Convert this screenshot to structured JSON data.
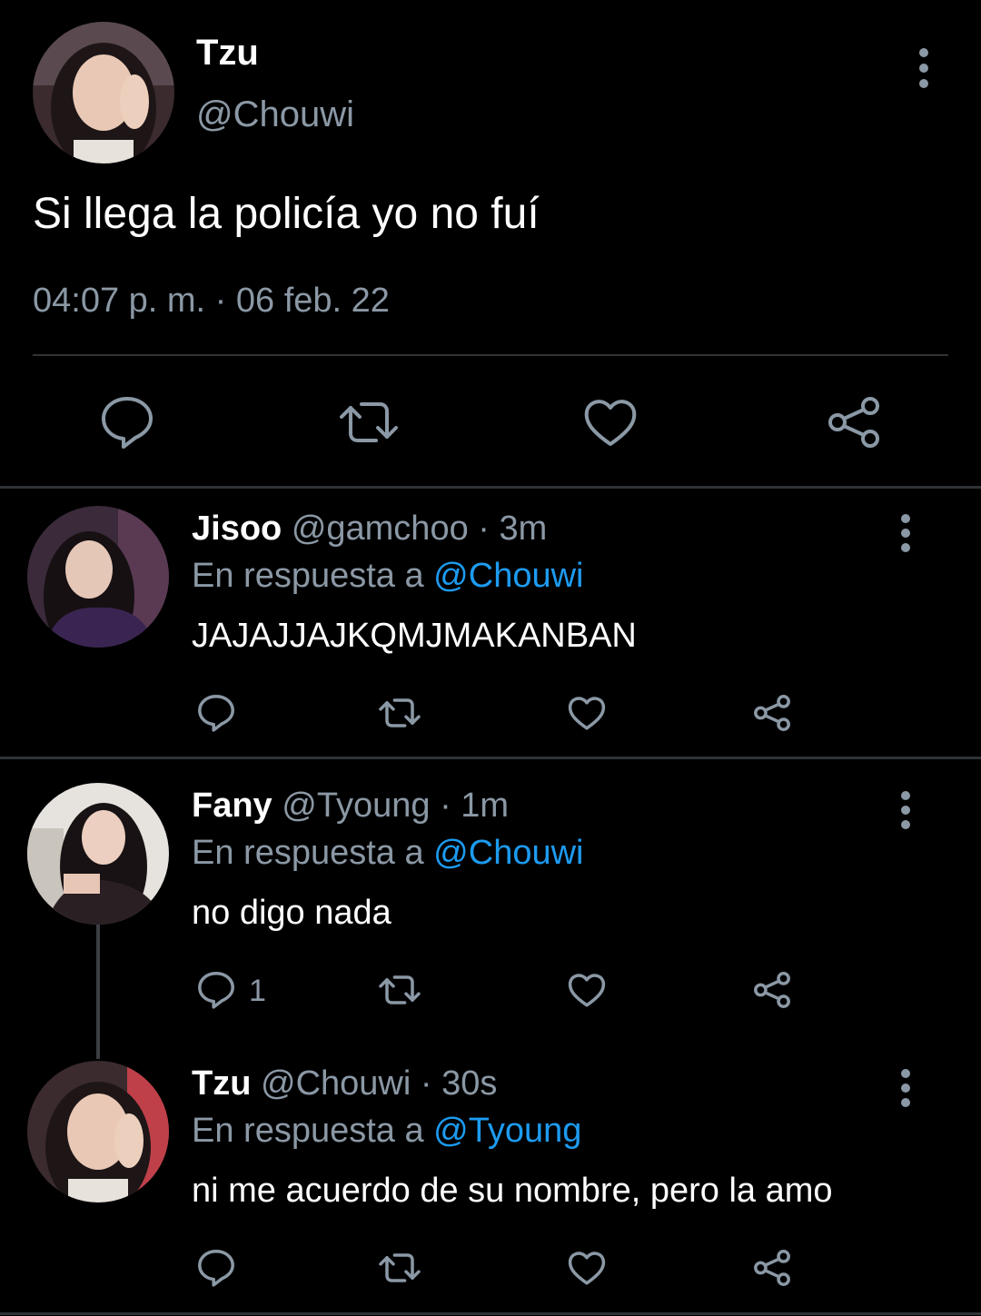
{
  "main_tweet": {
    "author_name": "Tzu",
    "author_handle": "@Chouwi",
    "text": "Si llega la policía yo no fuí",
    "timestamp": "04:07 p. m. · 06 feb. 22",
    "actions": [
      "reply-icon",
      "retweet-icon",
      "like-icon",
      "share-icon"
    ]
  },
  "replies": [
    {
      "name": "Jisoo",
      "handle": "@gamchoo",
      "time": "· 3m",
      "replying_prefix": "En respuesta a",
      "replying_to": "@Chouwi",
      "text": "JAJAJJAJKQMJMAKANBAN",
      "reply_count": ""
    },
    {
      "name": "Fany",
      "handle": "@Tyoung",
      "time": "· 1m",
      "replying_prefix": "En respuesta a",
      "replying_to": "@Chouwi",
      "text": "no digo nada",
      "reply_count": "1"
    },
    {
      "name": "Tzu",
      "handle": "@Chouwi",
      "time": "· 30s",
      "replying_prefix": "En respuesta a",
      "replying_to": "@Tyoung",
      "text": "ni me acuerdo de su nombre, pero la amo",
      "reply_count": ""
    }
  ],
  "colors": {
    "background": "#000000",
    "text": "#ffffff",
    "muted": "#8b98a5",
    "mention": "#1d9bf0",
    "divider": "#2f3336"
  }
}
